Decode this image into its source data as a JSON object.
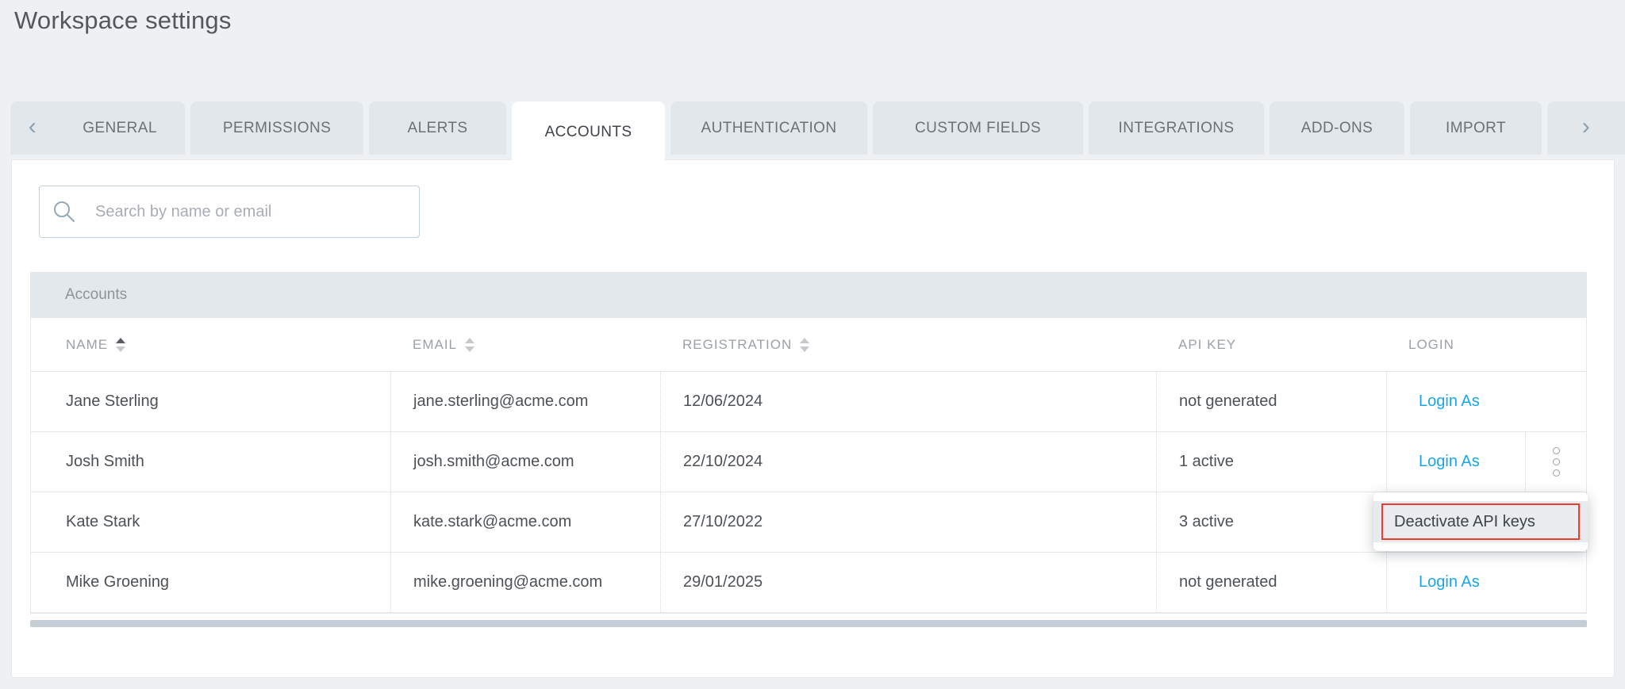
{
  "page": {
    "title": "Workspace settings"
  },
  "tabs": {
    "scroll_left_icon": "‹",
    "scroll_right_icon": "›",
    "items": [
      {
        "label": "GENERAL",
        "active": false
      },
      {
        "label": "PERMISSIONS",
        "active": false
      },
      {
        "label": "ALERTS",
        "active": false
      },
      {
        "label": "ACCOUNTS",
        "active": true
      },
      {
        "label": "AUTHENTICATION",
        "active": false
      },
      {
        "label": "CUSTOM FIELDS",
        "active": false
      },
      {
        "label": "INTEGRATIONS",
        "active": false
      },
      {
        "label": "ADD-ONS",
        "active": false
      },
      {
        "label": "IMPORT",
        "active": false
      }
    ]
  },
  "search": {
    "placeholder": "Search by name or email",
    "value": ""
  },
  "table": {
    "caption": "Accounts",
    "columns": [
      {
        "label": "NAME",
        "sort": "asc"
      },
      {
        "label": "EMAIL",
        "sort": "none"
      },
      {
        "label": "REGISTRATION",
        "sort": "none"
      },
      {
        "label": "API KEY",
        "sort": null
      },
      {
        "label": "LOGIN",
        "sort": null
      }
    ],
    "rows": [
      {
        "name": "Jane Sterling",
        "email": "jane.sterling@acme.com",
        "registration": "12/06/2024",
        "api_key": "not generated",
        "login": "Login As"
      },
      {
        "name": "Josh Smith",
        "email": "josh.smith@acme.com",
        "registration": "22/10/2024",
        "api_key": "1 active",
        "login": "Login As",
        "has_kebab_menu": true
      },
      {
        "name": "Kate Stark",
        "email": "kate.stark@acme.com",
        "registration": "27/10/2022",
        "api_key": "3 active",
        "login": ""
      },
      {
        "name": "Mike Groening",
        "email": "mike.groening@acme.com",
        "registration": "29/01/2025",
        "api_key": "not generated",
        "login": "Login As"
      }
    ]
  },
  "context_menu": {
    "items": [
      {
        "label": "Deactivate API keys",
        "highlighted": true
      }
    ]
  },
  "colors": {
    "page_background": "#edf1f4",
    "tab_background": "#e2e7eb",
    "active_tab_background": "#ffffff",
    "link_blue": "#1aa6e9",
    "annotation_red": "#f13b2d",
    "caption_bar": "#e3e8ec",
    "scrollbar_thumb": "#c5ced6"
  }
}
